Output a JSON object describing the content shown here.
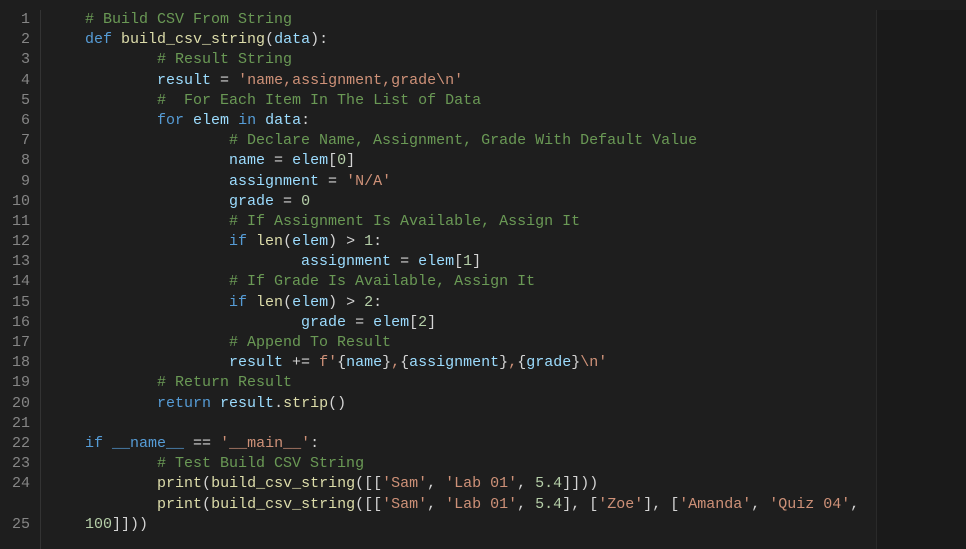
{
  "lines": [
    {
      "n": 1,
      "tokens": [
        [
          "    ",
          ""
        ],
        [
          "# Build CSV From String",
          "cm"
        ]
      ]
    },
    {
      "n": 2,
      "tokens": [
        [
          "    ",
          ""
        ],
        [
          "def ",
          "kw"
        ],
        [
          "build_csv_string",
          "fn"
        ],
        [
          "(",
          "pn"
        ],
        [
          "data",
          "va"
        ],
        [
          "):",
          "pn"
        ]
      ]
    },
    {
      "n": 3,
      "tokens": [
        [
          "            ",
          ""
        ],
        [
          "# Result String",
          "cm"
        ]
      ]
    },
    {
      "n": 4,
      "tokens": [
        [
          "            ",
          ""
        ],
        [
          "result",
          "va"
        ],
        [
          " = ",
          "op"
        ],
        [
          "'name,assignment,grade\\n'",
          "st"
        ]
      ]
    },
    {
      "n": 5,
      "tokens": [
        [
          "            ",
          ""
        ],
        [
          "#  For Each Item In The List of Data",
          "cm"
        ]
      ]
    },
    {
      "n": 6,
      "tokens": [
        [
          "            ",
          ""
        ],
        [
          "for ",
          "kw"
        ],
        [
          "elem",
          "va"
        ],
        [
          " in ",
          "kw"
        ],
        [
          "data",
          "va"
        ],
        [
          ":",
          "pn"
        ]
      ]
    },
    {
      "n": 7,
      "tokens": [
        [
          "                    ",
          ""
        ],
        [
          "# Declare Name, Assignment, Grade With Default Value",
          "cm"
        ]
      ]
    },
    {
      "n": 8,
      "tokens": [
        [
          "                    ",
          ""
        ],
        [
          "name",
          "va"
        ],
        [
          " = ",
          "op"
        ],
        [
          "elem",
          "va"
        ],
        [
          "[",
          "pn"
        ],
        [
          "0",
          "nu"
        ],
        [
          "]",
          "pn"
        ]
      ]
    },
    {
      "n": 9,
      "tokens": [
        [
          "                    ",
          ""
        ],
        [
          "assignment",
          "va"
        ],
        [
          " = ",
          "op"
        ],
        [
          "'N/A'",
          "st"
        ]
      ]
    },
    {
      "n": 10,
      "tokens": [
        [
          "                    ",
          ""
        ],
        [
          "grade",
          "va"
        ],
        [
          " = ",
          "op"
        ],
        [
          "0",
          "nu"
        ]
      ]
    },
    {
      "n": 11,
      "tokens": [
        [
          "                    ",
          ""
        ],
        [
          "# If Assignment Is Available, Assign It",
          "cm"
        ]
      ]
    },
    {
      "n": 12,
      "tokens": [
        [
          "                    ",
          ""
        ],
        [
          "if ",
          "kw"
        ],
        [
          "len",
          "fn"
        ],
        [
          "(",
          "pn"
        ],
        [
          "elem",
          "va"
        ],
        [
          ") > ",
          "pn"
        ],
        [
          "1",
          "nu"
        ],
        [
          ":",
          "pn"
        ]
      ]
    },
    {
      "n": 13,
      "tokens": [
        [
          "                            ",
          ""
        ],
        [
          "assignment",
          "va"
        ],
        [
          " = ",
          "op"
        ],
        [
          "elem",
          "va"
        ],
        [
          "[",
          "pn"
        ],
        [
          "1",
          "nu"
        ],
        [
          "]",
          "pn"
        ]
      ]
    },
    {
      "n": 14,
      "tokens": [
        [
          "                    ",
          ""
        ],
        [
          "# If Grade Is Available, Assign It",
          "cm"
        ]
      ]
    },
    {
      "n": 15,
      "tokens": [
        [
          "                    ",
          ""
        ],
        [
          "if ",
          "kw"
        ],
        [
          "len",
          "fn"
        ],
        [
          "(",
          "pn"
        ],
        [
          "elem",
          "va"
        ],
        [
          ") > ",
          "pn"
        ],
        [
          "2",
          "nu"
        ],
        [
          ":",
          "pn"
        ]
      ]
    },
    {
      "n": 16,
      "tokens": [
        [
          "                            ",
          ""
        ],
        [
          "grade",
          "va"
        ],
        [
          " = ",
          "op"
        ],
        [
          "elem",
          "va"
        ],
        [
          "[",
          "pn"
        ],
        [
          "2",
          "nu"
        ],
        [
          "]",
          "pn"
        ]
      ]
    },
    {
      "n": 17,
      "tokens": [
        [
          "                    ",
          ""
        ],
        [
          "# Append To Result",
          "cm"
        ]
      ]
    },
    {
      "n": 18,
      "tokens": [
        [
          "                    ",
          ""
        ],
        [
          "result",
          "va"
        ],
        [
          " += ",
          "op"
        ],
        [
          "f'",
          "st"
        ],
        [
          "{",
          "pn"
        ],
        [
          "name",
          "va"
        ],
        [
          "}",
          "pn"
        ],
        [
          ",",
          "st"
        ],
        [
          "{",
          "pn"
        ],
        [
          "assignment",
          "va"
        ],
        [
          "}",
          "pn"
        ],
        [
          ",",
          "st"
        ],
        [
          "{",
          "pn"
        ],
        [
          "grade",
          "va"
        ],
        [
          "}",
          "pn"
        ],
        [
          "\\n'",
          "st"
        ]
      ]
    },
    {
      "n": 19,
      "tokens": [
        [
          "            ",
          ""
        ],
        [
          "# Return Result",
          "cm"
        ]
      ]
    },
    {
      "n": 20,
      "tokens": [
        [
          "            ",
          ""
        ],
        [
          "return ",
          "kw"
        ],
        [
          "result",
          "va"
        ],
        [
          ".",
          "pn"
        ],
        [
          "strip",
          "fn"
        ],
        [
          "()",
          "pn"
        ]
      ]
    },
    {
      "n": 21,
      "tokens": [
        [
          "",
          ""
        ]
      ]
    },
    {
      "n": 22,
      "tokens": [
        [
          "    ",
          ""
        ],
        [
          "if ",
          "kw"
        ],
        [
          "__name__",
          "mg"
        ],
        [
          " == ",
          "op"
        ],
        [
          "'__main__'",
          "st"
        ],
        [
          ":",
          "pn"
        ]
      ]
    },
    {
      "n": 23,
      "tokens": [
        [
          "            ",
          ""
        ],
        [
          "# Test Build CSV String",
          "cm"
        ]
      ]
    },
    {
      "n": 24,
      "tokens": [
        [
          "            ",
          ""
        ],
        [
          "print",
          "fn"
        ],
        [
          "(",
          "pn"
        ],
        [
          "build_csv_string",
          "fn"
        ],
        [
          "([[",
          "pn"
        ],
        [
          "'Sam'",
          "st"
        ],
        [
          ", ",
          "pn"
        ],
        [
          "'Lab 01'",
          "st"
        ],
        [
          ", ",
          "pn"
        ],
        [
          "5.4",
          "nu"
        ],
        [
          "]]))",
          "pn"
        ]
      ]
    },
    {
      "n": "",
      "tokens": [
        [
          "            ",
          ""
        ],
        [
          "print",
          "fn"
        ],
        [
          "(",
          "pn"
        ],
        [
          "build_csv_string",
          "fn"
        ],
        [
          "([[",
          "pn"
        ],
        [
          "'Sam'",
          "st"
        ],
        [
          ", ",
          "pn"
        ],
        [
          "'Lab 01'",
          "st"
        ],
        [
          ", ",
          "pn"
        ],
        [
          "5.4",
          "nu"
        ],
        [
          "], [",
          "pn"
        ],
        [
          "'Zoe'",
          "st"
        ],
        [
          "], [",
          "pn"
        ],
        [
          "'Amanda'",
          "st"
        ],
        [
          ", ",
          "pn"
        ],
        [
          "'Quiz 04'",
          "st"
        ],
        [
          ", ",
          "pn"
        ]
      ]
    },
    {
      "n": 25,
      "tokens": [
        [
          "    ",
          ""
        ],
        [
          "100",
          "nu"
        ],
        [
          "]]))",
          "pn"
        ]
      ]
    }
  ]
}
